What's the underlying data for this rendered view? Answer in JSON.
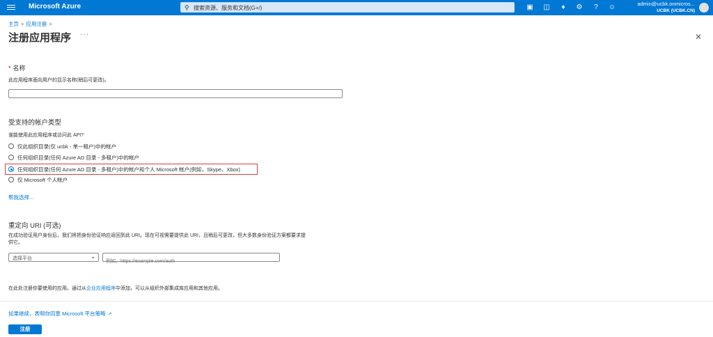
{
  "header": {
    "brand": "Microsoft Azure",
    "search_placeholder": "搜索资源、服务和文档(G+/)",
    "account_name": "admin@ucbk.onmicros...",
    "account_tenant": "UCBK (UCBK.CN)",
    "icons": [
      "cloud-shell-icon",
      "directory-filter-icon",
      "notifications-icon",
      "settings-icon",
      "help-icon",
      "feedback-icon"
    ]
  },
  "breadcrumb": {
    "home": "主页",
    "app_reg": "应用注册"
  },
  "page": {
    "title": "注册应用程序",
    "more": "···"
  },
  "name_section": {
    "label": "名称",
    "help": "此应用程序面向用户的显示名称(稍后可更改)。",
    "value": ""
  },
  "account_types": {
    "heading": "受支持的帐户类型",
    "question": "谁能使用此应用程序或访问此 API?",
    "options": [
      {
        "label": "仅此组织目录(仅 ucbk - 单一租户)中的帐户",
        "selected": false
      },
      {
        "label": "任何组织目录(任何 Azure AD 目录 - 多租户)中的帐户",
        "selected": false
      },
      {
        "label": "任何组织目录(任何 Azure AD 目录 - 多租户)中的帐户和个人 Microsoft 帐户(例如，Skype、Xbox)",
        "selected": true
      },
      {
        "label": "仅 Microsoft 个人帐户",
        "selected": false
      }
    ],
    "help_link": "帮我选择..."
  },
  "redirect": {
    "heading": "重定向 URI (可选)",
    "desc_line1": "在成功验证用户身份后，我们将把身份验证响应返回到此 URI。现在可视需要提供此 URI，且稍后可更改，但大多数身份验证方案都要求提",
    "desc_line2": "供它。",
    "platform": "选择平台",
    "uri_placeholder": "例如，https://example.com/auth"
  },
  "footer_note": {
    "before": "在此处注册你要使用的应用。通过从",
    "link": "企业应用程序",
    "after": "中添加，可以从组织外部集成库应用和其他应用。"
  },
  "policy_link": "如果继续，表明你同意 Microsoft 平台策略",
  "register_button": "注册"
}
